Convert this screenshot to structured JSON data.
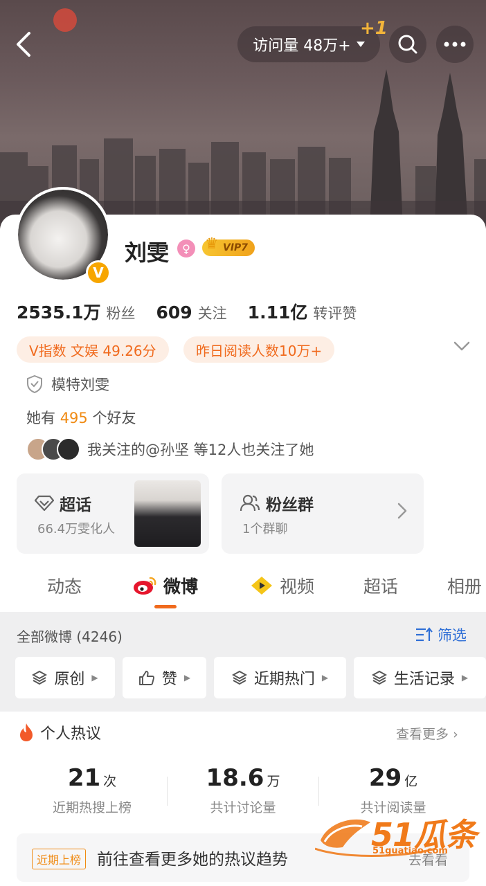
{
  "header": {
    "visits_label": "访问量 48万+",
    "plus_one": "+1"
  },
  "profile": {
    "name": "刘雯",
    "vip_label": "VIP7",
    "verified_mark": "V"
  },
  "stats": [
    {
      "value": "2535.1万",
      "label": "粉丝"
    },
    {
      "value": "609",
      "label": "关注"
    },
    {
      "value": "1.11亿",
      "label": "转评赞"
    }
  ],
  "pills": {
    "v_index": "V指数 文娱 49.26分",
    "yesterday_reads": "昨日阅读人数10万+"
  },
  "certification": "模特刘雯",
  "friends": {
    "prefix": "她有",
    "count": "495",
    "suffix": "个好友"
  },
  "mutual_follow": "我关注的@孙坚 等12人也关注了她",
  "tiles": {
    "super_topic": {
      "title": "超话",
      "subtitle": "66.4万雯化人"
    },
    "fan_group": {
      "title": "粉丝群",
      "subtitle": "1个群聊"
    }
  },
  "tabs": [
    "动态",
    "微博",
    "视频",
    "超话",
    "相册"
  ],
  "active_tab": "微博",
  "filter": {
    "title": "全部微博 (4246)",
    "filter_label": "筛选",
    "chips": [
      "原创",
      "赞",
      "近期热门",
      "生活记录"
    ]
  },
  "hot": {
    "title": "个人热议",
    "see_more": "查看更多",
    "metrics": [
      {
        "value": "21",
        "unit": "次",
        "label": "近期热搜上榜"
      },
      {
        "value": "18.6",
        "unit": "万",
        "label": "共计讨论量"
      },
      {
        "value": "29",
        "unit": "亿",
        "label": "共计阅读量"
      }
    ],
    "trend_tag": "近期上榜",
    "trend_text": "前往查看更多她的热议趋势",
    "trend_go": "去看看"
  },
  "watermark": {
    "text": "51瓜条",
    "url": "51guatiao.com"
  },
  "colors": {
    "accent": "#f06a1d",
    "link_blue": "#2f6fd6",
    "vip_gold": "#f7c531"
  }
}
